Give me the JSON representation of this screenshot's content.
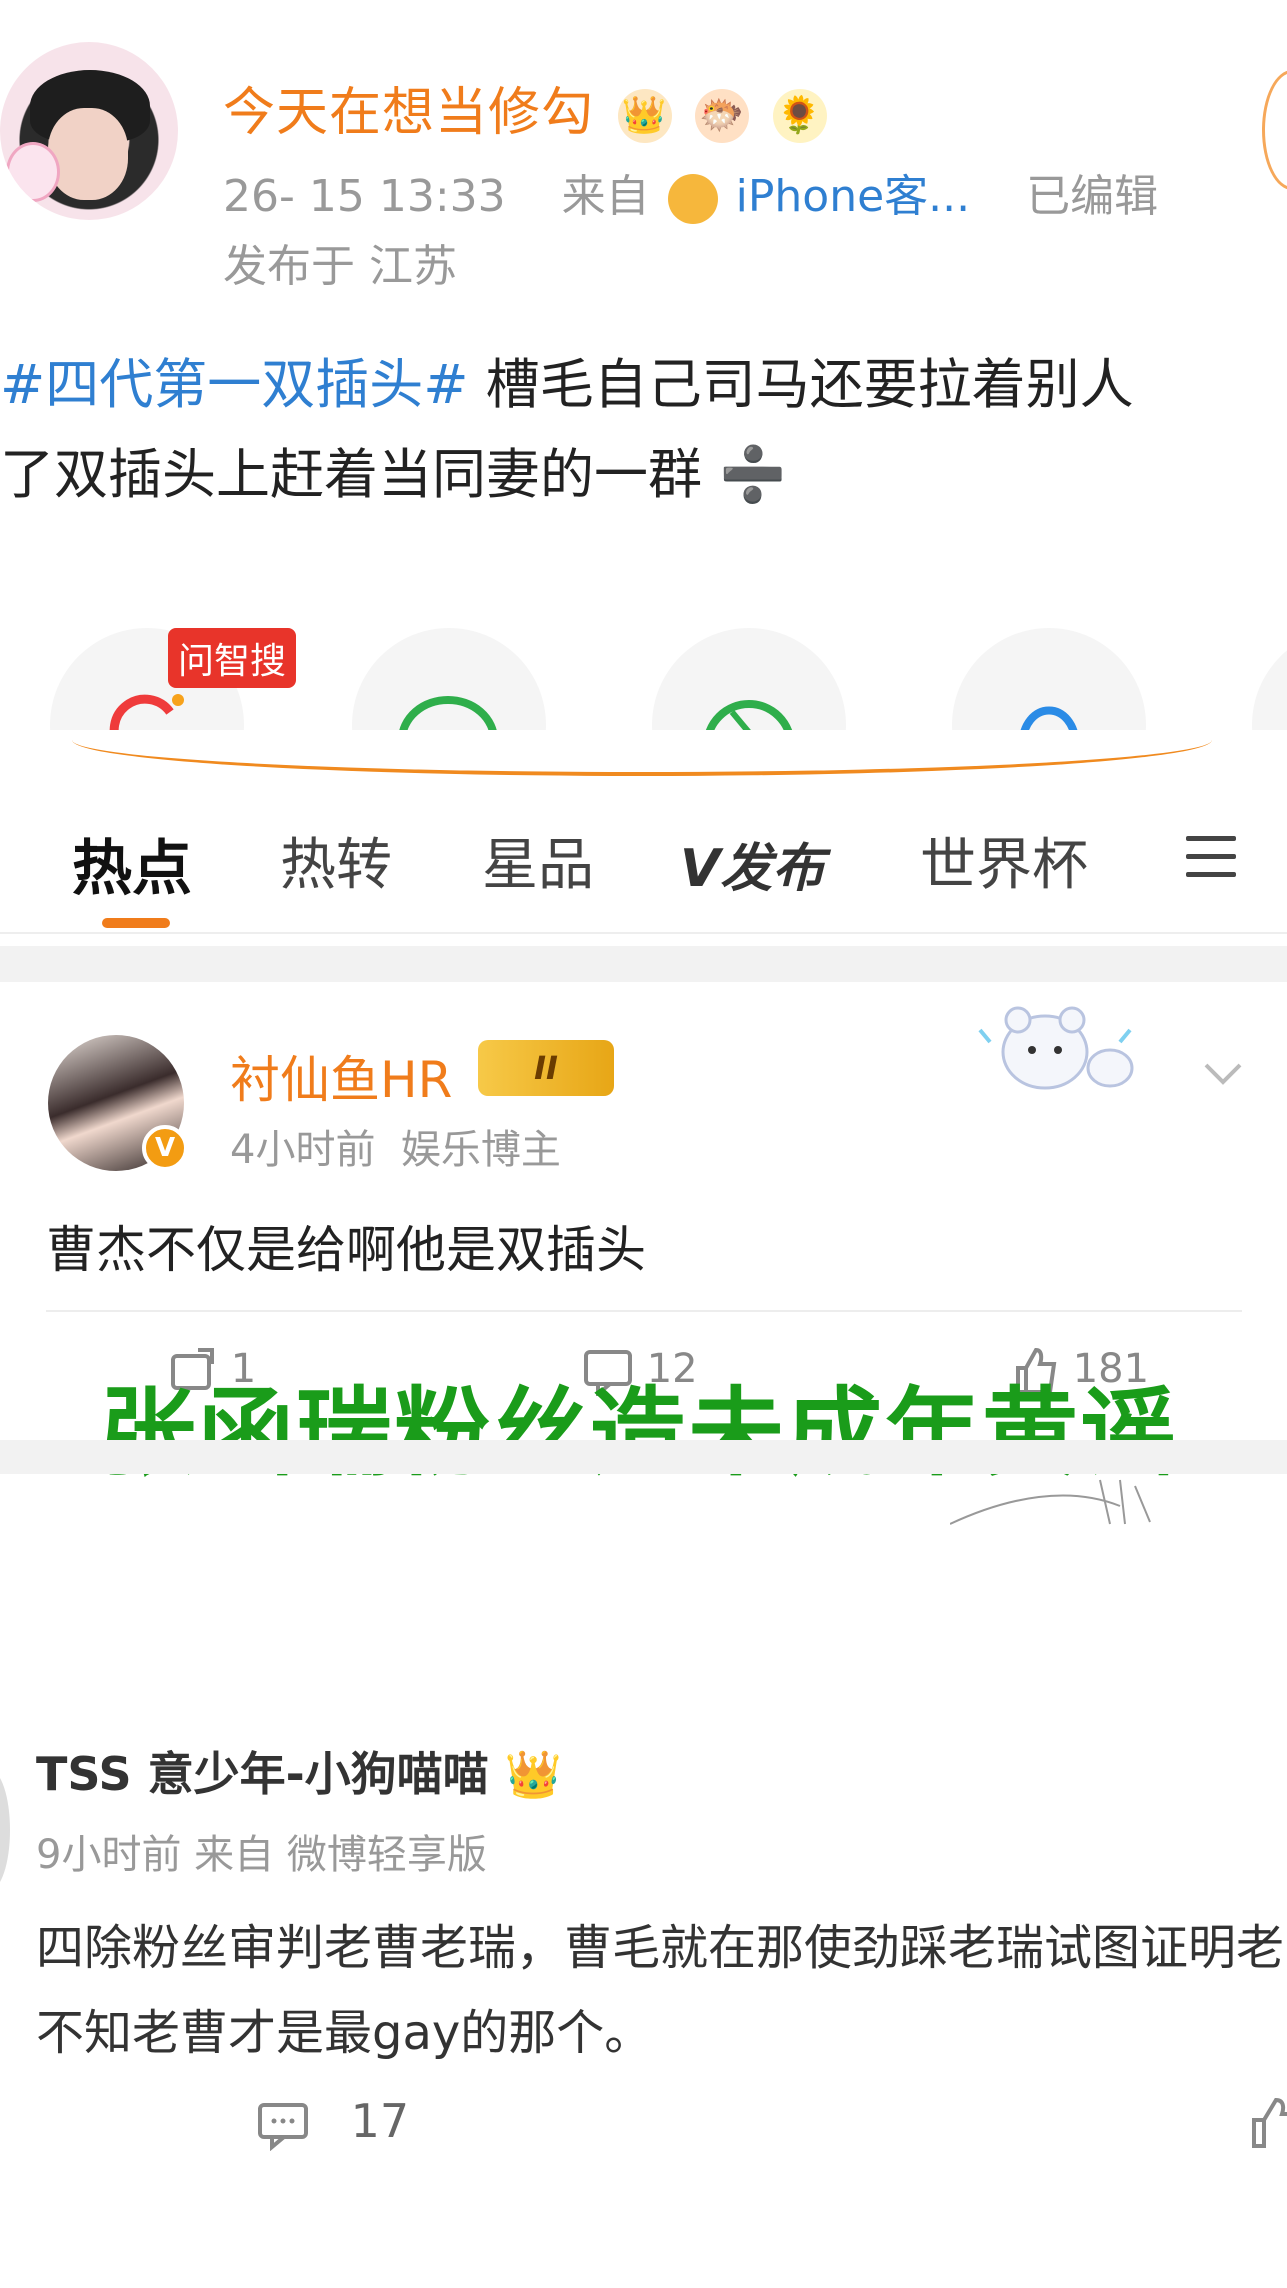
{
  "post1": {
    "username": "今天在想当修勾",
    "badges": [
      "👑",
      "🐡",
      "🌻"
    ],
    "time": "26-‌ 15 13:33",
    "source_prefix": "来自",
    "source": "iPhone客...",
    "edited": "已编辑",
    "location": "发布于 江苏",
    "hashtag": "#四代第一双插头#",
    "text_line1": " 槽毛自己司马还要拉着别人",
    "text_line2": "了双插头上赶着当同妻的一群 ➗",
    "share_tag": "问智搜"
  },
  "tabs": {
    "hot": "热点",
    "repost": "热转",
    "star": "星品",
    "publish": "V发布",
    "worldcup": "世界杯"
  },
  "post2": {
    "username": "衬仙鱼HR",
    "crown_label": "II",
    "vbadge": "V",
    "time": "4小时前",
    "role": "娱乐博主",
    "text": "曹杰不仅是给啊他是双插头",
    "repost_count": "1",
    "comment_count": "12",
    "like_count": "181"
  },
  "overlay": {
    "text": "张函瑞粉丝造未成年黄谣"
  },
  "post3": {
    "username": "TSS‌ 意少年-小狗喵喵 👑",
    "meta": "9小时前 来自 微博轻享版",
    "text_line1": "四除粉丝审判老曹老瑞，曹毛就在那使劲踩老瑞试图证明老",
    "text_line2": "不知老曹才是最gay的那个。",
    "comment_count": "17"
  },
  "colors": {
    "accent_orange": "#f07c1b",
    "link_blue": "#2f7fd1",
    "overlay_green": "#1a9c1a",
    "tag_red": "#e8342a"
  }
}
